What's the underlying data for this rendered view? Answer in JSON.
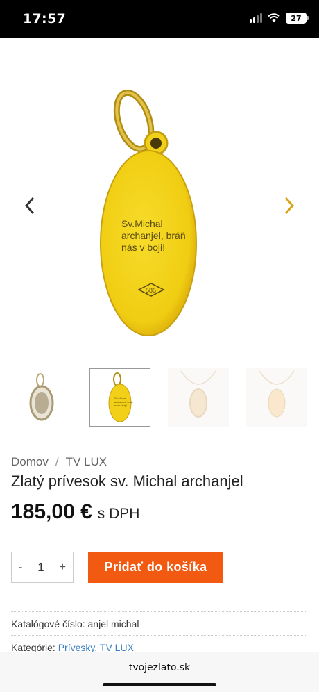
{
  "status": {
    "time": "17:57",
    "battery": "27"
  },
  "gallery": {
    "engraving_lines": [
      "Sv.Michal",
      "archanjel, bráň",
      "nás v boji!"
    ],
    "hallmark": "585"
  },
  "thumb_engraving": [
    "Sv.Michal",
    "archanjel, bráň",
    "nás v boji!"
  ],
  "breadcrumb": [
    "Domov",
    "/",
    "TV LUX"
  ],
  "product": {
    "title": "Zlatý prívesok sv. Michal archanjel",
    "price": "185,00 €",
    "vat": "s DPH"
  },
  "cart": {
    "minus": "-",
    "qty": "1",
    "plus": "+",
    "add_label": "Pridať do košíka"
  },
  "meta": {
    "sku_label": "Katalógové číslo:",
    "sku_value": "anjel michal",
    "cat_label": "Kategórie:",
    "cat_1": "Prívesky",
    "cat_sep": ",",
    "cat_2": "TV LUX"
  },
  "browser": {
    "url": "tvojezlato.sk"
  },
  "colors": {
    "accent": "#f25a12",
    "gold": "#f3d21c",
    "link": "#3a7fc1"
  }
}
